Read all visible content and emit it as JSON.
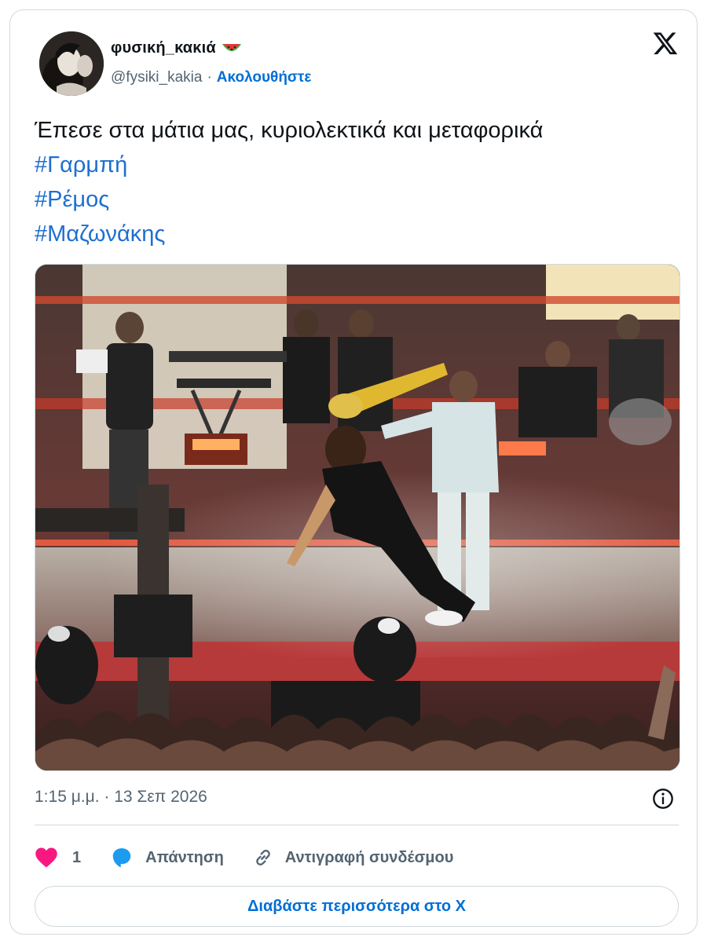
{
  "author": {
    "display_name": "φυσική_κακιά",
    "emoji_icon": "watermelon-icon",
    "handle": "@fysiki_kakia",
    "separator": "·",
    "follow_label": "Ακολουθήστε"
  },
  "tweet": {
    "text": "Έπεσε στα μάτια μας, κυριολεκτικά και μεταφορικά",
    "hashtags": [
      "#Γαρμπή",
      "#Ρέμος",
      "#Μαζωνάκης"
    ]
  },
  "media": {
    "description_icon": "concert-photo"
  },
  "meta": {
    "timestamp": "1:15 μ.μ. · 13 Σεπ 2026"
  },
  "actions": {
    "like_count": "1",
    "reply_label": "Απάντηση",
    "copy_link_label": "Αντιγραφή συνδέσμου"
  },
  "footer": {
    "read_more_label": "Διαβάστε περισσότερα στο X"
  },
  "colors": {
    "link_blue": "#006fd6",
    "hashtag_blue": "#1d6fd0",
    "like_pink": "#f91880",
    "reply_blue": "#1d9bf0",
    "muted_gray": "#536471",
    "border": "#cfd9de"
  }
}
